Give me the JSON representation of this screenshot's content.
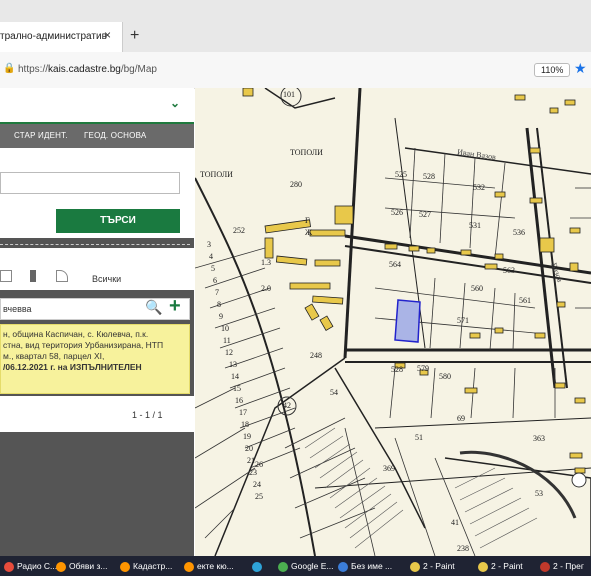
{
  "browser": {
    "tab_title": "трално-административ",
    "tab_close": "×",
    "new_tab": "+",
    "url_prefix": "https://",
    "url_domain": "kais.cadastre.bg",
    "url_path": "/bg/Map",
    "zoom": "110%"
  },
  "panel": {
    "tabs": [
      "СТАР ИДЕНТ.",
      "ГЕОД. ОСНОВА"
    ],
    "search_button": "ТЪРСИ",
    "all_label": "Всички",
    "filter_text": "вчевва",
    "result_lines": [
      "н, община Каспичан, с. Кюлевча, п.к.",
      "стна, вид територия Урбанизирана, НТП",
      "м., квартал 58, парцел XI,",
      "/06.12.2021 г. на ИЗПЪЛНИТЕЛЕН"
    ],
    "pager": "1 - 1 / 1"
  },
  "map": {
    "labels": [
      "101",
      "ТОПОЛИ",
      "ТОПОЛИ",
      "280",
      "252",
      "1.3",
      "2.0",
      "248",
      "54",
      "42",
      "26",
      "3",
      "4",
      "5",
      "6",
      "7",
      "8",
      "9",
      "10",
      "11",
      "12",
      "13",
      "14",
      "15",
      "16",
      "17",
      "18",
      "19",
      "20",
      "21",
      "23",
      "24",
      "25",
      "525",
      "528",
      "532",
      "526",
      "527",
      "531",
      "536",
      "564",
      "563",
      "560",
      "561",
      "571",
      "528",
      "579",
      "580",
      "69",
      "51",
      "363",
      "369",
      "53",
      "238",
      "41",
      "Г",
      "Ж"
    ],
    "street_labels": [
      "Иван Вазов",
      "Вазов"
    ]
  },
  "taskbar": {
    "items": [
      "Радио С...",
      "Обяви з...",
      "Кадастр...",
      "ектe кю...",
      "",
      "Google E...",
      "Без име ...",
      "2 - Paint",
      "2 - Paint",
      "2 - Прег"
    ]
  }
}
